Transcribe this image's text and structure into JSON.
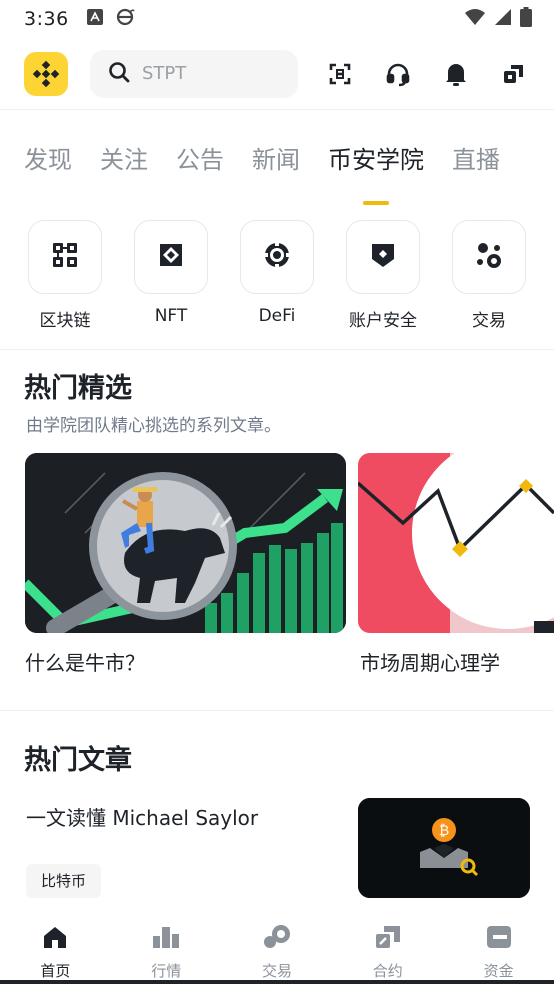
{
  "status_bar": {
    "time": "3:36"
  },
  "search": {
    "placeholder": "STPT"
  },
  "tabs": [
    {
      "label": "发现",
      "active": false
    },
    {
      "label": "关注",
      "active": false
    },
    {
      "label": "公告",
      "active": false
    },
    {
      "label": "新闻",
      "active": false
    },
    {
      "label": "币安学院",
      "active": true
    },
    {
      "label": "直播",
      "active": false
    }
  ],
  "categories": [
    {
      "label": "区块链",
      "icon": "blockchain-icon"
    },
    {
      "label": "NFT",
      "icon": "nft-icon"
    },
    {
      "label": "DeFi",
      "icon": "defi-icon"
    },
    {
      "label": "账户安全",
      "icon": "security-icon"
    },
    {
      "label": "交易",
      "icon": "trade-icon"
    }
  ],
  "featured": {
    "title": "热门精选",
    "subtitle": "由学院团队精心挑选的系列文章。",
    "cards": [
      {
        "caption": "什么是牛市？"
      },
      {
        "caption": "市场周期心理学"
      }
    ]
  },
  "articles": {
    "title": "热门文章",
    "items": [
      {
        "title": "一文读懂 Michael Saylor",
        "tag": "比特币"
      }
    ]
  },
  "bottom_nav": [
    {
      "label": "首页",
      "icon": "home-icon",
      "active": true
    },
    {
      "label": "行情",
      "icon": "markets-icon",
      "active": false
    },
    {
      "label": "交易",
      "icon": "trade-icon",
      "active": false
    },
    {
      "label": "合约",
      "icon": "futures-icon",
      "active": false
    },
    {
      "label": "资金",
      "icon": "wallet-icon",
      "active": false
    }
  ],
  "colors": {
    "brand": "#fcd535",
    "accent": "#f0b90b",
    "text": "#1e2329",
    "muted": "#8b929a"
  }
}
